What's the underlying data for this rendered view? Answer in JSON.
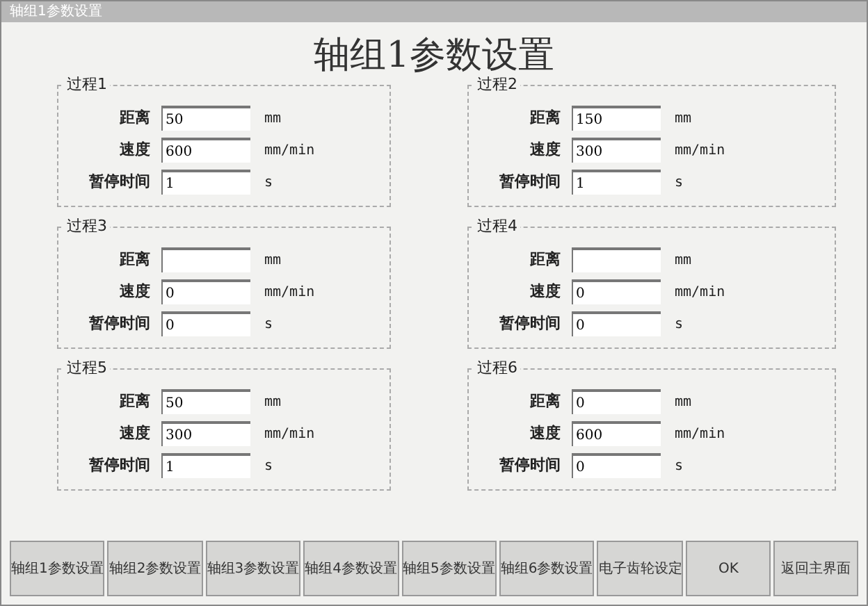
{
  "window": {
    "title": "轴组1参数设置"
  },
  "heading": "轴组1参数设置",
  "groups": [
    {
      "title": "过程1",
      "fields": [
        {
          "label": "距离",
          "value": "50",
          "unit": "mm"
        },
        {
          "label": "速度",
          "value": "600",
          "unit": "mm/min"
        },
        {
          "label": "暂停时间",
          "value": "1",
          "unit": "s"
        }
      ]
    },
    {
      "title": "过程2",
      "fields": [
        {
          "label": "距离",
          "value": "150",
          "unit": "mm"
        },
        {
          "label": "速度",
          "value": "300",
          "unit": "mm/min"
        },
        {
          "label": "暂停时间",
          "value": "1",
          "unit": "s"
        }
      ]
    },
    {
      "title": "过程3",
      "fields": [
        {
          "label": "距离",
          "unit": "mm"
        },
        {
          "label": "速度",
          "value": "0",
          "unit": "mm/min"
        },
        {
          "label": "暂停时间",
          "value": "0",
          "unit": "s"
        }
      ]
    },
    {
      "title": "过程4",
      "fields": [
        {
          "label": "距离",
          "unit": "mm"
        },
        {
          "label": "速度",
          "value": "0",
          "unit": "mm/min"
        },
        {
          "label": "暂停时间",
          "value": "0",
          "unit": "s"
        }
      ]
    },
    {
      "title": "过程5",
      "fields": [
        {
          "label": "距离",
          "value": "50",
          "unit": "mm"
        },
        {
          "label": "速度",
          "value": "300",
          "unit": "mm/min"
        },
        {
          "label": "暂停时间",
          "value": "1",
          "unit": "s"
        }
      ]
    },
    {
      "title": "过程6",
      "fields": [
        {
          "label": "距离",
          "value": "0",
          "unit": "mm"
        },
        {
          "label": "速度",
          "value": "600",
          "unit": "mm/min"
        },
        {
          "label": "暂停时间",
          "value": "0",
          "unit": "s"
        }
      ]
    }
  ],
  "buttons": [
    "轴组1参数设置",
    "轴组2参数设置",
    "轴组3参数设置",
    "轴组4参数设置",
    "轴组5参数设置",
    "轴组6参数设置",
    "电子齿轮设定",
    "OK",
    "返回主界面"
  ]
}
